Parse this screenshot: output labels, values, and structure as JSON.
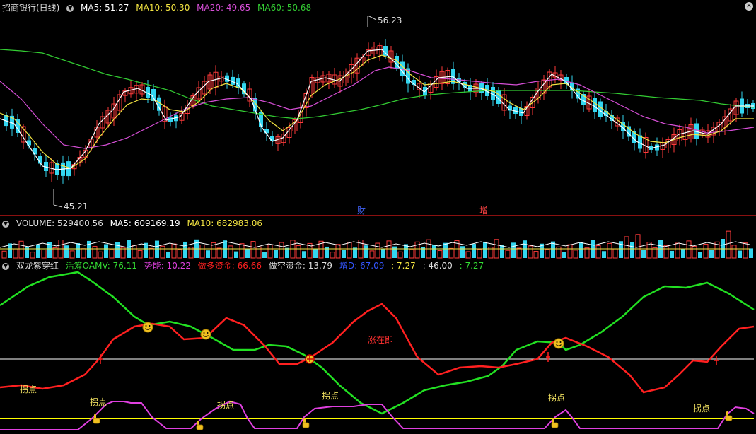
{
  "main_header": {
    "title": "招商银行(日线)",
    "ma5": "MA5: 51.27",
    "ma10": "MA10: 50.30",
    "ma20": "MA20: 49.65",
    "ma60": "MA60: 50.68"
  },
  "price_labels": {
    "high": "56.23",
    "low": "45.21"
  },
  "event_markers": [
    "财",
    "增"
  ],
  "volume_header": {
    "volume": "VOLUME: 529400.56",
    "ma5": "MA5: 609169.19",
    "ma10": "MA10: 682983.06"
  },
  "indicator_header": {
    "name": "双龙紫穿红",
    "active": "活筹OAMV: 76.11",
    "momentum": "势能: 10.22",
    "long_funds": "做多资金: 66.66",
    "short_funds": "做空资金: 13.79",
    "d_value": "增D: 67.09",
    "v1": ": 7.27",
    "v2": ": 46.00",
    "v3": ": 7.27"
  },
  "annotations": {
    "turning_point": "拐点",
    "rising": "涨在即"
  },
  "colors": {
    "up": "#ff3a3a",
    "down": "#33d6f0",
    "ma5": "#ffffff",
    "ma10": "#f5e642",
    "ma20": "#d84fd8",
    "ma60": "#33cc33",
    "green_line": "#22e022",
    "red_line": "#ff2020",
    "magenta_line": "#e040e0",
    "threshold": "#ffff00"
  },
  "icons": [
    "arrow-down-icon",
    "close-icon",
    "smiley-icon",
    "hand-pointer-icon",
    "plus-circle-icon"
  ],
  "chart_data": [
    {
      "type": "candlestick",
      "title": "招商银行(日线)",
      "price_range": [
        45.21,
        56.23
      ],
      "series": [
        {
          "name": "MA5",
          "last": 51.27
        },
        {
          "name": "MA10",
          "last": 50.3
        },
        {
          "name": "MA20",
          "last": 49.65
        },
        {
          "name": "MA60",
          "last": 50.68
        }
      ],
      "high_label": 56.23,
      "low_label": 45.21
    },
    {
      "type": "bar",
      "title": "VOLUME",
      "series": [
        {
          "name": "VOLUME",
          "last": 529400.56
        },
        {
          "name": "MA5",
          "last": 609169.19
        },
        {
          "name": "MA10",
          "last": 682983.06
        }
      ]
    },
    {
      "type": "line",
      "title": "双龙紫穿红",
      "series": [
        {
          "name": "活筹OAMV",
          "last": 76.11
        },
        {
          "name": "势能",
          "last": 10.22
        },
        {
          "name": "做多资金",
          "last": 66.66
        },
        {
          "name": "做空资金",
          "last": 13.79
        },
        {
          "name": "增D",
          "last": 67.09
        }
      ]
    }
  ]
}
